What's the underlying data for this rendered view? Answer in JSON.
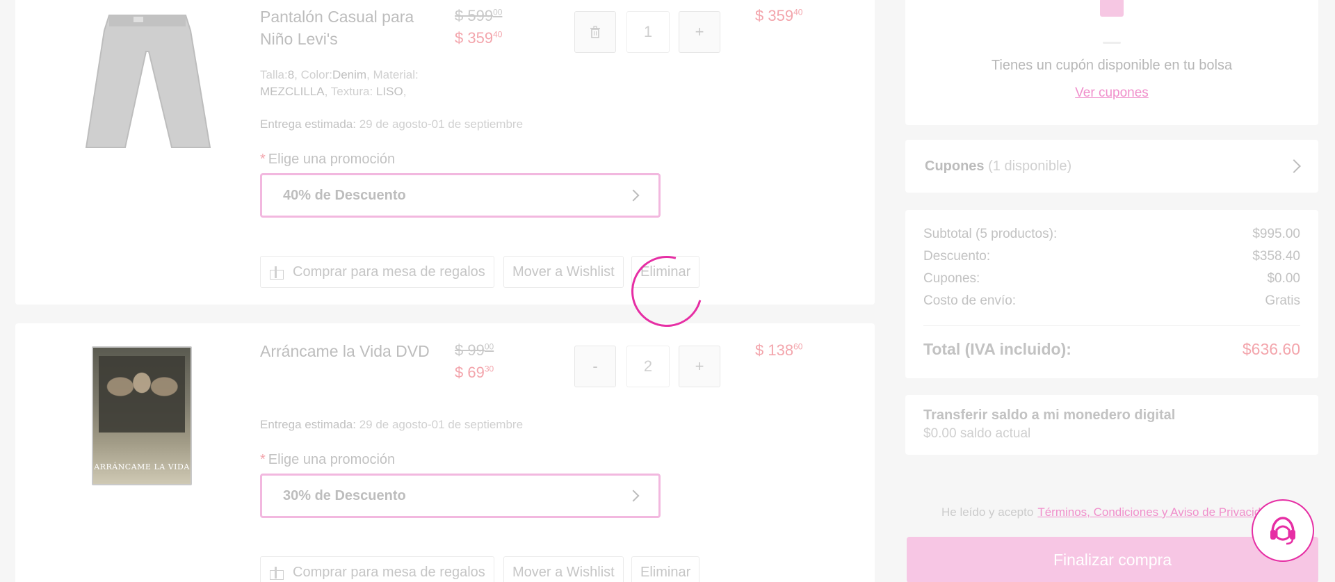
{
  "items": [
    {
      "name": "Pantalón Casual para Niño Levi's",
      "old_price": "$ 599",
      "old_cents": "00",
      "new_price": "$ 359",
      "new_cents": "40",
      "line_price": "$ 359",
      "line_cents": "40",
      "quantity": "1",
      "qty_left_icon": "trash-icon",
      "qty_right_label": "+",
      "attrs": {
        "talla_label": "Talla:",
        "talla": "8",
        "color_label": ", Color:",
        "color": "Denim",
        "material_label": ", Material:",
        "material": "MEZCLILLA",
        "textura_label": ", Textura:",
        "textura": "LISO",
        "end": ","
      },
      "delivery_label": "Entrega estimada:",
      "delivery_value": "29 de agosto-01 de septiembre",
      "promo_label": "Elige una promoción",
      "promo_value": "40% de Descuento",
      "actions": [
        "Comprar para mesa de regalos",
        "Mover a Wishlist",
        "Eliminar"
      ]
    },
    {
      "name": "Arráncame la Vida DVD",
      "old_price": "$ 99",
      "old_cents": "00",
      "new_price": "$ 69",
      "new_cents": "30",
      "line_price": "$ 138",
      "line_cents": "60",
      "quantity": "2",
      "qty_left_label": "-",
      "qty_right_label": "+",
      "cover_title": "ARRÁNCAME LA VIDA",
      "delivery_label": "Entrega estimada:",
      "delivery_value": "29 de agosto-01 de septiembre",
      "promo_label": "Elige una promoción",
      "promo_value": "30% de Descuento",
      "actions": [
        "Comprar para mesa de regalos",
        "Mover a Wishlist",
        "Eliminar"
      ]
    }
  ],
  "coupon_card": {
    "text": "Tienes un cupón disponible en tu bolsa",
    "link": "Ver cupones"
  },
  "cupones_row": {
    "label": "Cupones",
    "count": "(1 disponible)"
  },
  "summary": {
    "rows": [
      {
        "label": "Subtotal (5 productos):",
        "value": "$995.00"
      },
      {
        "label": "Descuento:",
        "value": "$358.40"
      },
      {
        "label": "Cupones:",
        "value": "$0.00"
      },
      {
        "label": "Costo de envío:",
        "value": "Gratis"
      }
    ],
    "total_label": "Total (IVA incluido):",
    "total_value": "$636.60"
  },
  "wallet": {
    "title": "Transferir saldo a mi monedero digital",
    "subtitle": "$0.00 saldo actual"
  },
  "terms": {
    "prefix": "He leído y acepto",
    "link": "Términos, Condiciones y Aviso de Privacidad"
  },
  "checkout_label": "Finalizar compra",
  "colors": {
    "accent": "#e62ea4",
    "price": "#f3a5ac",
    "checkout_bg": "#f7c6e4"
  }
}
